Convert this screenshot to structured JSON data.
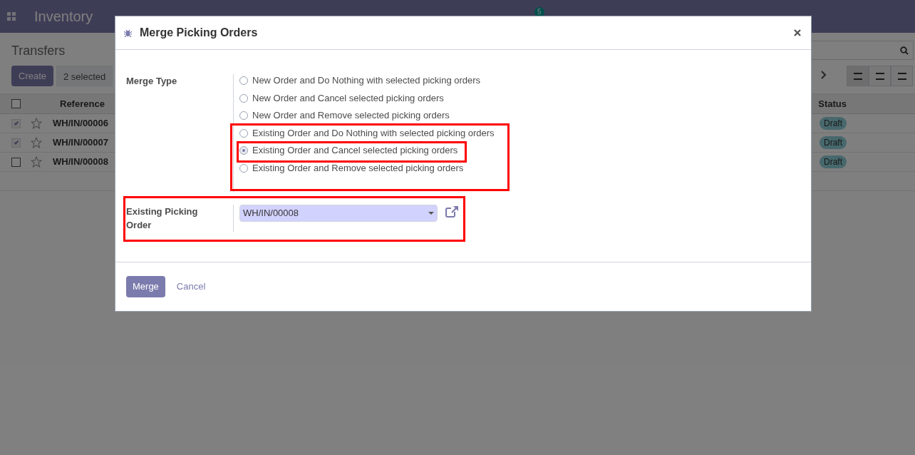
{
  "navbar": {
    "app_title": "Inventory",
    "chat_count": "5"
  },
  "control_panel": {
    "title": "Transfers",
    "create_button": "Create",
    "selection_count": "2 selected"
  },
  "table": {
    "all_selected": false,
    "columns": [
      "Reference",
      "Status"
    ],
    "rows": [
      {
        "reference": "WH/IN/00006",
        "status": "Draft",
        "checked": true
      },
      {
        "reference": "WH/IN/00007",
        "status": "Draft",
        "checked": true
      },
      {
        "reference": "WH/IN/00008",
        "status": "Draft",
        "checked": false
      }
    ]
  },
  "dialog": {
    "title": "Merge Picking Orders",
    "merge_type_label": "Merge Type",
    "options": [
      {
        "label": "New Order and Do Nothing with selected picking orders",
        "selected": false
      },
      {
        "label": "New Order and Cancel selected picking orders",
        "selected": false
      },
      {
        "label": "New Order and Remove selected picking orders",
        "selected": false
      },
      {
        "label": "Existing Order and Do Nothing with selected picking orders",
        "selected": false
      },
      {
        "label": "Existing Order and Cancel selected picking orders",
        "selected": true
      },
      {
        "label": "Existing Order and Remove selected picking orders",
        "selected": false
      }
    ],
    "existing_label": "Existing Picking Order",
    "existing_value": "WH/IN/00008",
    "buttons": [
      "Merge",
      "Cancel"
    ]
  }
}
